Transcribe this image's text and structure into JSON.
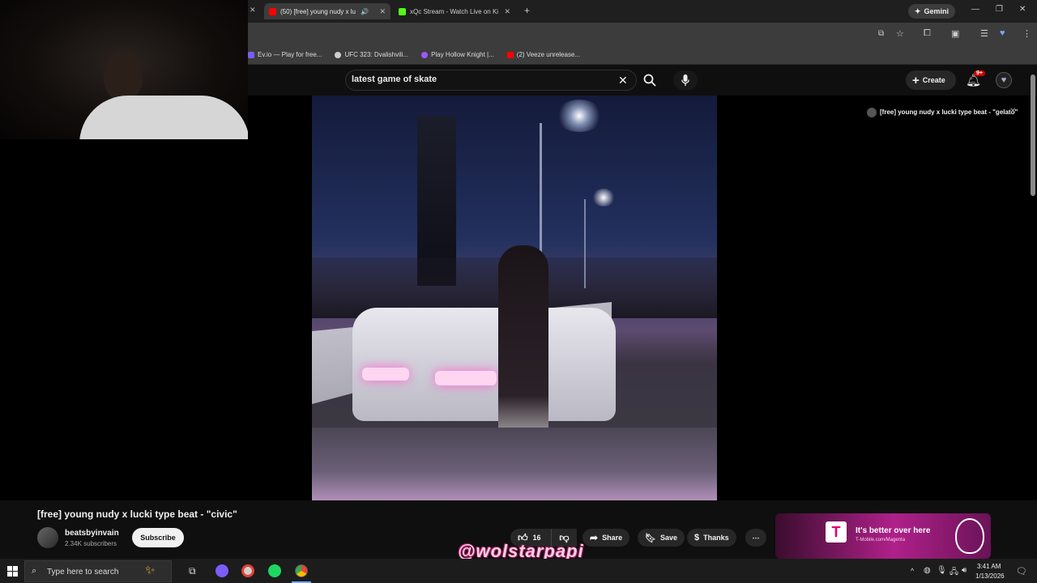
{
  "browser": {
    "tabs": [
      {
        "label": "(50) [free] young nudy x lu",
        "active": true
      },
      {
        "label": "xQc Stream - Watch Live on Ki",
        "active": false
      }
    ],
    "gemini_label": "Gemini",
    "bookmarks": [
      "Ev.io — Play for free...",
      "UFC 323: Dvalishvili...",
      "Play Hollow Knight |...",
      "(2) Veeze unrelease..."
    ]
  },
  "youtube": {
    "search_value": "latest game of skate",
    "create_label": "Create",
    "notif_badge": "9+",
    "video_title": "[free] young nudy x lucki type beat - \"civic\"",
    "channel": "beatsbyinvain",
    "subscribers": "2.34K subscribers",
    "subscribe_label": "Subscribe",
    "likes": "16",
    "share_label": "Share",
    "save_label": "Save",
    "thanks_label": "Thanks",
    "miniplayer_title": "[free] young nudy x lucki type beat - \"gelato\"",
    "ad_text": "It's better over here",
    "ad_subtext": "T-Mobile.com/Magenta"
  },
  "watermark": "@wolstarpapi",
  "taskbar": {
    "search_placeholder": "Type here to search",
    "time": "3:41 AM",
    "date": "1/13/2026"
  },
  "colors": {
    "accent": "#ff0000",
    "tmobile": "#e20074"
  }
}
